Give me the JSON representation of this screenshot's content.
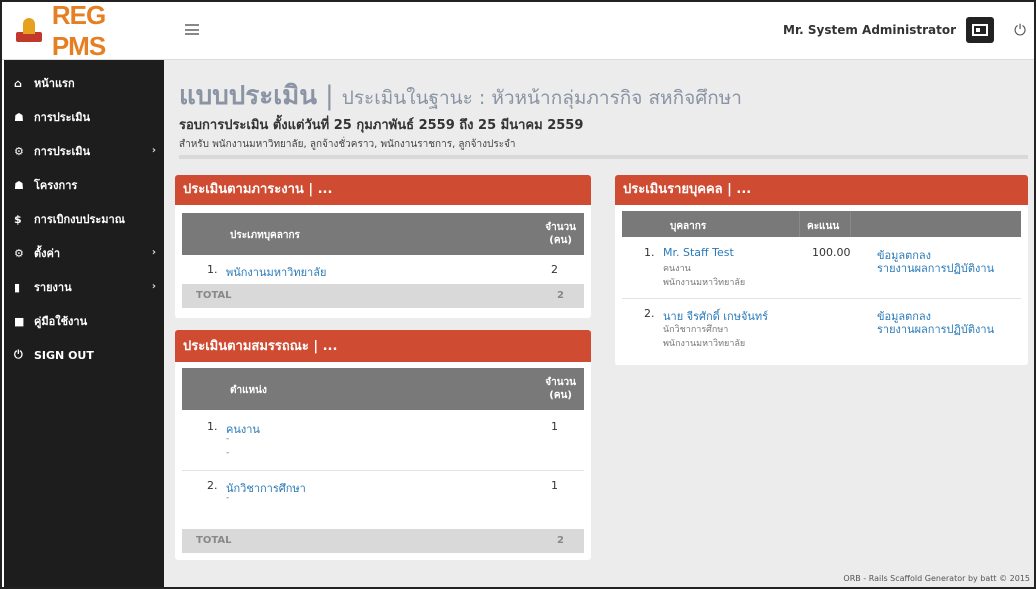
{
  "app": {
    "logo": "REG PMS"
  },
  "header": {
    "user": "Mr. System Administrator"
  },
  "sidebar": {
    "items": [
      {
        "label": "หน้าแรก",
        "icon": "home-icon",
        "glyph": "⌂",
        "chevron": false
      },
      {
        "label": "การประเมิน",
        "icon": "users-icon",
        "glyph": "☗",
        "chevron": false
      },
      {
        "label": "การประเมิน",
        "icon": "cogs-icon",
        "glyph": "⚙",
        "chevron": true
      },
      {
        "label": "โครงการ",
        "icon": "users-icon",
        "glyph": "☗",
        "chevron": false
      },
      {
        "label": "การเบิกงบประมาณ",
        "icon": "dollar-icon",
        "glyph": "$",
        "chevron": false
      },
      {
        "label": "ตั้งค่า",
        "icon": "cogs-icon",
        "glyph": "⚙",
        "chevron": true
      },
      {
        "label": "รายงาน",
        "icon": "bar-chart-icon",
        "glyph": "▮",
        "chevron": true
      },
      {
        "label": "คู่มือใช้งาน",
        "icon": "book-icon",
        "glyph": "■",
        "chevron": false
      },
      {
        "label": "SIGN OUT",
        "icon": "power-icon",
        "glyph": "⏻",
        "chevron": false
      }
    ]
  },
  "page": {
    "title": "แบบประเมิน",
    "separator": "|",
    "subtitle": "ประเมินในฐานะ : หัวหน้ากลุ่มภารกิจ สหกิจศึกษา",
    "round": "รอบการประเมิน ตั้งแต่วันที่ 25 กุมภาพันธ์ 2559 ถึง 25 มีนาคม 2559",
    "for": "สำหรับ พนักงานมหาวิทยาลัย, ลูกจ้างชั่วคราว, พนักงานราชการ, ลูกจ้างประจำ"
  },
  "workload": {
    "title": "ประเมินตามภาระงาน | ...",
    "col1": "ประเภทบุคลากร",
    "col2_line1": "จำนวน",
    "col2_line2": "(คน)",
    "rows": [
      {
        "no": "1.",
        "name": "พนักงานมหาวิทยาลัย",
        "count": "2"
      }
    ],
    "total_label": "TOTAL",
    "total": "2"
  },
  "competency": {
    "title": "ประเมินตามสมรรถณะ | ...",
    "col1": "ตำแหน่ง",
    "col2_line1": "จำนวน",
    "col2_line2": "(คน)",
    "rows": [
      {
        "no": "1.",
        "name": "คนงาน",
        "sub1": "-",
        "sub2": "-",
        "count": "1"
      },
      {
        "no": "2.",
        "name": "นักวิชาการศึกษา",
        "sub1": "-",
        "count": "1"
      }
    ],
    "total_label": "TOTAL",
    "total": "2"
  },
  "individual": {
    "title": "ประเมินรายบุคคล | ...",
    "col_person": "บุคลากร",
    "col_score": "คะแนน",
    "rows": [
      {
        "no": "1.",
        "name": "Mr. Staff Test",
        "position": "คนงาน",
        "type": "พนักงานมหาวิทยาลัย",
        "score": "100.00",
        "link1": "ข้อมูลตกลง",
        "link2": "รายงานผลการปฏิบัติงาน"
      },
      {
        "no": "2.",
        "name": "นาย จีรศักดิ์ เกษจันทร์",
        "position": "นักวิชาการศึกษา",
        "type": "พนักงานมหาวิทยาลัย",
        "score": "",
        "link1": "ข้อมูลตกลง",
        "link2": "รายงานผลการปฏิบัติงาน"
      }
    ]
  },
  "footer": "ORB - Rails Scaffold Generator by batt © 2015",
  "colors": {
    "accent": "#cf4b32",
    "sidebar": "#1d1d1d",
    "link": "#2a7ab8",
    "logo": "#e67e22"
  }
}
